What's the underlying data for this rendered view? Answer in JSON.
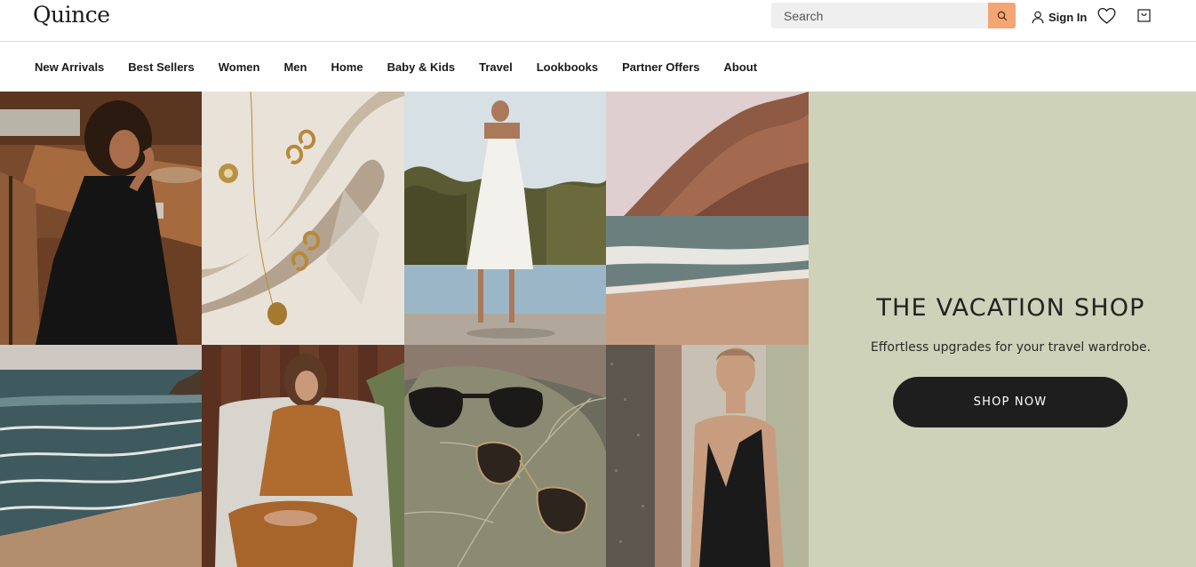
{
  "header": {
    "logo": "Quince",
    "search_placeholder": "Search",
    "sign_in_label": "Sign In"
  },
  "nav": {
    "items": [
      {
        "label": "New Arrivals"
      },
      {
        "label": "Best Sellers"
      },
      {
        "label": "Women"
      },
      {
        "label": "Men"
      },
      {
        "label": "Home"
      },
      {
        "label": "Baby & Kids"
      },
      {
        "label": "Travel"
      },
      {
        "label": "Lookbooks"
      },
      {
        "label": "Partner Offers"
      },
      {
        "label": "About"
      }
    ]
  },
  "hero": {
    "title": "THE VACATION SHOP",
    "subtitle": "Effortless upgrades for your travel wardrobe.",
    "cta_label": "SHOP NOW",
    "panel_color": "#ced2b8",
    "accent_color": "#f4a574"
  },
  "icons": {
    "search": "search-icon",
    "user": "user-icon",
    "wishlist": "heart-icon",
    "cart": "shopping-bag-icon"
  }
}
